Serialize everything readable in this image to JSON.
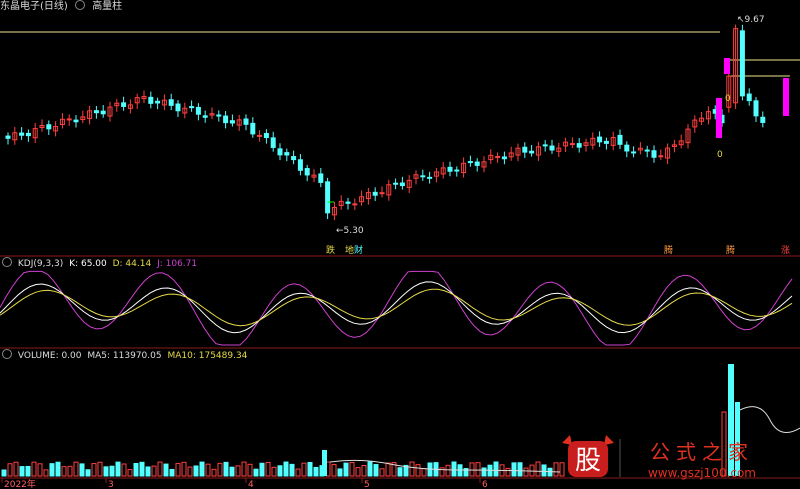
{
  "header": {
    "stock_name": "东晶电子(日线)",
    "indicator": "高量柱"
  },
  "price_labels": {
    "high": "9.67",
    "low": "5.30",
    "zero_a": "0",
    "zero_b": "0"
  },
  "markers": [
    "跌",
    "地",
    "财",
    "腾",
    "腾",
    "涨"
  ],
  "kdj": {
    "title": "KDJ(9,3,3)",
    "k": "K: 65.00",
    "d": "D: 44.14",
    "j": "J: 106.71",
    "colors": {
      "k": "#ffffff",
      "d": "#e6d94a",
      "j": "#d040d0"
    }
  },
  "volume": {
    "title": "VOLUME: 0.00",
    "ma5": "MA5: 113970.05",
    "ma10": "MA10: 175489.34"
  },
  "x_axis": [
    "2022年",
    "3",
    "4",
    "5",
    "6"
  ],
  "watermark": {
    "logo": "股",
    "text": "公式之家",
    "url": "www.gszj100.com"
  },
  "colors": {
    "up": "#ff4040",
    "down": "#54ffff",
    "signal": "#ff00ff",
    "line": "#f0e68c",
    "divider": "#8b1a1a"
  },
  "chart_data": {
    "type": "candlestick",
    "price_range": [
      5.0,
      10.0
    ],
    "annotations": {
      "high": 9.67,
      "low": 5.3
    },
    "candles_count": 112,
    "key_points": [
      {
        "label": "local high (Feb)",
        "value": 8.2
      },
      {
        "label": "low",
        "value": 5.3
      },
      {
        "label": "high",
        "value": 9.67
      }
    ],
    "kdj": {
      "k": 65.0,
      "d": 44.14,
      "j": 106.71
    },
    "volume": {
      "ma5": 113970.05,
      "ma10": 175489.34
    }
  }
}
